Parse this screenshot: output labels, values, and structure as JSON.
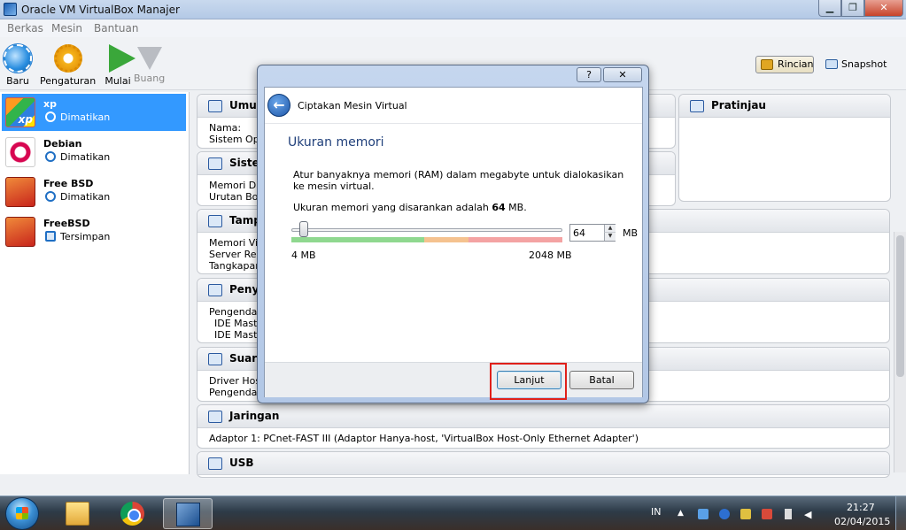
{
  "window": {
    "title": "Oracle VM VirtualBox Manajer"
  },
  "menu": [
    "Berkas",
    "Mesin",
    "Bantuan"
  ],
  "toolbar": {
    "new_label": "Baru",
    "settings_label": "Pengaturan",
    "start_label": "Mulai",
    "discard_label": "Buang",
    "details_label": "Rincian",
    "snapshot_label": "Snapshot"
  },
  "vms": [
    {
      "name": "xp",
      "state": "Dimatikan"
    },
    {
      "name": "Debian",
      "state": "Dimatikan"
    },
    {
      "name": "Free BSD",
      "state": "Dimatikan"
    },
    {
      "name": "FreeBSD",
      "state": "Tersimpan"
    }
  ],
  "details": {
    "general": {
      "title": "Umum",
      "lines": [
        "Nama:",
        "Sistem Oper"
      ]
    },
    "preview": {
      "title": "Pratinjau"
    },
    "system": {
      "title": "Sistem",
      "lines": [
        "Memori Dasa",
        "Urutan Boot"
      ]
    },
    "display": {
      "title": "Tampilan",
      "lines": [
        "Memori Video",
        "Server Remo",
        "Tangkapan V"
      ]
    },
    "storage": {
      "title": "Penyimpanan",
      "lines": [
        "Pengendali:",
        "  IDE Master",
        "  IDE Master"
      ]
    },
    "audio": {
      "title": "Suara",
      "lines": [
        "Driver Host:",
        "Pengendali:"
      ]
    },
    "network": {
      "title": "Jaringan",
      "lines": [
        "Adaptor 1:   PCnet-FAST III (Adaptor Hanya-host, 'VirtualBox Host-Only Ethernet Adapter')"
      ]
    },
    "usb": {
      "title": "USB"
    }
  },
  "dialog": {
    "help_label": "?",
    "close_label": "✕",
    "title": "Ciptakan Mesin Virtual",
    "heading": "Ukuran memori",
    "description": "Atur banyaknya memori (RAM) dalam megabyte untuk dialokasikan ke mesin virtual.",
    "recommended_prefix": "Ukuran memori yang disarankan adalah ",
    "recommended_value": "64",
    "recommended_suffix": " MB.",
    "memory_value": "64",
    "memory_unit": "MB",
    "min_label": "4 MB",
    "max_label": "2048 MB",
    "slider_fraction": 0.03,
    "zones": {
      "green": "#8fd88f",
      "orange": "#f5c28f",
      "red": "#f4a3a3"
    },
    "next_label": "Lanjut",
    "cancel_label": "Batal"
  },
  "taskbar": {
    "language": "IN",
    "time": "21:27",
    "date": "02/04/2015"
  }
}
